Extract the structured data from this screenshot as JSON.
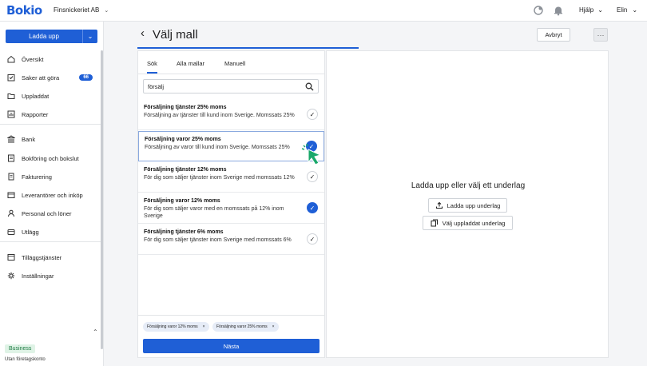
{
  "topbar": {
    "logo": "Bokio",
    "company": "Finsnickeriet AB",
    "help": "Hjälp",
    "user": "Elin",
    "icons": [
      "chevron-down-icon",
      "activity-icon",
      "bell-icon"
    ]
  },
  "sidebar": {
    "upload_label": "Ladda upp",
    "items": [
      {
        "label": "Översikt",
        "icon": "home-icon"
      },
      {
        "label": "Saker att göra",
        "icon": "todo-icon",
        "badge": "66"
      },
      {
        "label": "Uppladdat",
        "icon": "folder-icon"
      },
      {
        "label": "Rapporter",
        "icon": "chart-icon"
      },
      {
        "label": "Bank",
        "icon": "bank-icon"
      },
      {
        "label": "Bokföring och bokslut",
        "icon": "ledger-icon"
      },
      {
        "label": "Fakturering",
        "icon": "invoice-icon"
      },
      {
        "label": "Leverantörer och inköp",
        "icon": "supplier-icon"
      },
      {
        "label": "Personal och löner",
        "icon": "person-icon"
      },
      {
        "label": "Utlägg",
        "icon": "wallet-icon"
      },
      {
        "label": "Tilläggstjänster",
        "icon": "addon-icon"
      },
      {
        "label": "Inställningar",
        "icon": "gear-icon"
      }
    ],
    "plan_badge": "Business",
    "plan_sub": "Utan företagskonto"
  },
  "header": {
    "title": "Välj mall",
    "cancel_label": "Avbryt",
    "more_label": "···"
  },
  "left_panel": {
    "tabs": [
      {
        "label": "Sök",
        "active": true
      },
      {
        "label": "Alla mallar",
        "active": false
      },
      {
        "label": "Manuell",
        "active": false
      }
    ],
    "search_value": "försälj",
    "templates": [
      {
        "title": "Försäljning tjänster 25% moms",
        "desc": "Försäljning av tjänster till kund inom Sverige. Momssats 25%",
        "selected": false
      },
      {
        "title": "Försäljning varor 25% moms",
        "desc": "Försäljning av varor till kund inom Sverige. Momssats 25%",
        "selected": true
      },
      {
        "title": "Försäljning tjänster 12% moms",
        "desc": "För dig som säljer tjänster inom Sverige med momssats 12%",
        "selected": false
      },
      {
        "title": "Försäljning varor 12% moms",
        "desc": "För dig som säljer varor med en momssats på 12% inom Sverige",
        "selected": true
      },
      {
        "title": "Försäljning tjänster 6% moms",
        "desc": "För dig som säljer tjänster inom Sverige med momssats 6%",
        "selected": false
      }
    ],
    "chips": [
      "Försäljning varor 12% moms",
      "Försäljning varor 25% moms"
    ],
    "chip_close": "×",
    "next_label": "Nästa"
  },
  "right_panel": {
    "title": "Ladda upp eller välj ett underlag",
    "upload_label": "Ladda upp underlag",
    "choose_label": "Välj uppladdat underlag"
  },
  "colors": {
    "accent": "#1f5fd6",
    "cursor": "#1aa86a"
  }
}
